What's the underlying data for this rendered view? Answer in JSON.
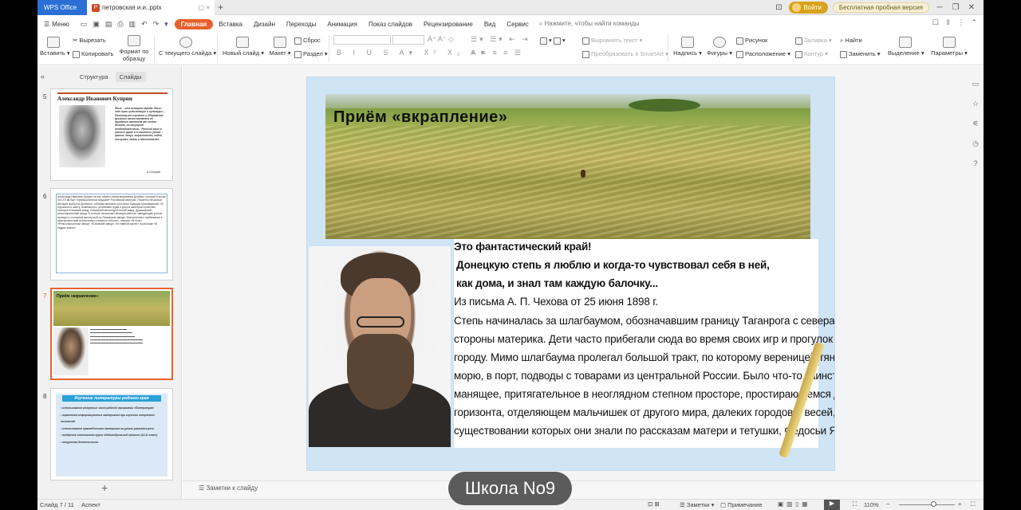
{
  "titlebar": {
    "app_tab": "WPS Office",
    "file_tab": "петровская и.и..pptx",
    "login": "Войти",
    "trial": "Бесплатная пробная версия"
  },
  "menu": {
    "menu_label": "Меню",
    "tabs": [
      "Главная",
      "Вставка",
      "Дизайн",
      "Переходы",
      "Анимация",
      "Показ слайдов",
      "Рецензирование",
      "Вид",
      "Сервис"
    ],
    "active_tab": "Главная",
    "search_placeholder": "Нажмите, чтобы найти команды"
  },
  "ribbon": {
    "paste": "Вставить",
    "cut": "Вырезать",
    "copy": "Копировать",
    "format_painter_1": "Формат по",
    "format_painter_2": "образцу",
    "from_current": "С текущего слайда",
    "new_slide": "Новый слайд",
    "layout": "Макет",
    "reset": "Сброс",
    "section": "Раздел",
    "align_text": "Выровнять текст",
    "convert_smartart": "Преобразовать в SmartArt",
    "textbox": "Надпись",
    "shapes": "Фигуры",
    "picture": "Рисунок",
    "arrange": "Расположение",
    "fill": "Заливка",
    "outline": "Контур",
    "find": "Найти",
    "replace": "Заменить",
    "select": "Выделение",
    "settings": "Параметры"
  },
  "left_pane": {
    "tab_structure": "Структура",
    "tab_slides": "Слайды",
    "slide_numbers": [
      "5",
      "6",
      "7",
      "8"
    ],
    "thumb5_title": "Александр Иванович Куприн",
    "thumb5_text": "Язык – это история народа. Язык – это путь цивилизации и культуры... Поэтому-то изучение и сбережение русского языка является не праздным занятием от нечего делать, но насущной необходимостью... Русский язык в умелых руках и в опытных устах – красив, певуч, выразителен, гибок, послушен, ловок и вместителен.",
    "thumb5_sig": "А.И.Куприн",
    "thumb6_text": "Александр Иванович Куприн не мог обойти своим вниманием Донбасс, который в конце XIX-XX вв был «промышленным сердцем» Российской империи. Писатель несколько месяцев пробыл в Донбассе, собирая материал для своих будущих произведений. Он спускался в шахту, знакомился с условиями труда и досуга шахтёров и рабочих, посещал Юзовский завод, Ломовский металлургический завод, Дружковский рельсопрокатный завод. В течение нескольких месяцев работал заведующим учетом кузницы и столярной мастерской на Ломовском заводе. Впечатления о пребывании в шахтерском крае воплотились в повести «Молох», очерках «В огне», «Рельсопрокатный завод», «Юзовский завод», «В главной шахте», в рассказе «В недрах земли».",
    "thumb7_title": "Приём «вкрапление»",
    "thumb8_title": "Изучение литературы родного края",
    "thumb8_items": [
      "использование резервных часов рабочей программы «Литература»",
      "вкрапления информационных материалов при изучении творческих писателей",
      "использование краеведческого материала на уроках развития речи",
      "внедрение элективного курса «Индивидуальный проект» (10-11 класс)",
      "внеурочная деятельность"
    ]
  },
  "slide": {
    "title": "Приём «вкрапление»",
    "line1": "Это фантастический край!",
    "line2": "Донецкую степь я люблю и когда-то чувствовал себя в ней,",
    "line3": "как дома, и знал там каждую балочку...",
    "line4": "Из письма А. П. Чехова от 25 июня 1898 г.",
    "para": [
      "Степь начиналась за шлагбаумом, обозначавшим границу Таганрога с севера, со",
      "стороны материка. Дети часто прибегали сюда во время своих игр и прогулок по",
      "городу. Мимо шлагбаума пролегал большой тракт, по которому вереницей тянулись к",
      "морю, в порт, подводы с товарами из центральной России. Было что-то таинственное,",
      "манящее, притягательное в неоглядном степном просторе, простирающемся до",
      "горизонта, отделяющем мальчишек от другого мира, далеких городов и весей, о",
      "существовании которых они знали по рассказам матери и тетушки, Федосьи Яковлевны"
    ]
  },
  "notes_placeholder": "Заметки к слайду",
  "status": {
    "slide_counter": "Слайд 7 / 11",
    "theme": "Аспект",
    "notes_btn": "Заметки",
    "comment_btn": "Примечание",
    "zoom": "110%"
  },
  "watermark": "Школа No9"
}
